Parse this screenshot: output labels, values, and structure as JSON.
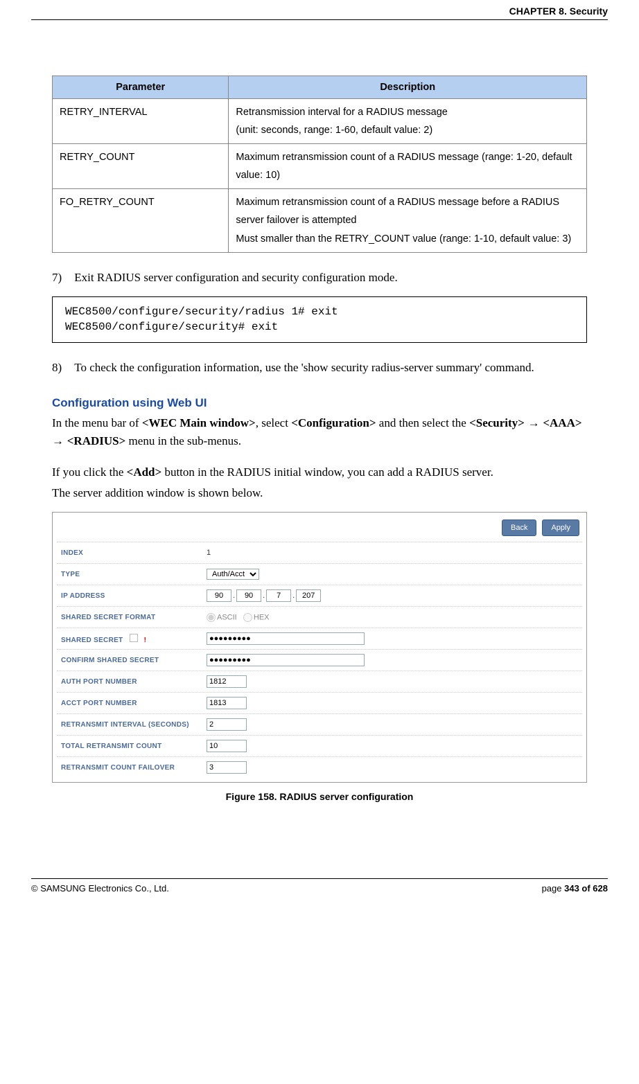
{
  "header": {
    "chapter": "CHAPTER 8. Security"
  },
  "table": {
    "headers": {
      "param": "Parameter",
      "desc": "Description"
    },
    "rows": [
      {
        "param": "RETRY_INTERVAL",
        "desc": "Retransmission interval for a RADIUS message\n(unit: seconds, range: 1-60, default value: 2)"
      },
      {
        "param": "RETRY_COUNT",
        "desc": "Maximum retransmission count of a RADIUS message (range: 1-20, default value: 10)"
      },
      {
        "param": "FO_RETRY_COUNT",
        "desc": "Maximum retransmission count of a RADIUS message before a RADIUS server failover is attempted\nMust smaller than the RETRY_COUNT value (range: 1-10, default value: 3)"
      }
    ]
  },
  "steps": {
    "s7": {
      "num": "7)",
      "text": "Exit RADIUS server configuration and security configuration mode."
    },
    "s8": {
      "num": "8)",
      "text": "To check the configuration information, use the 'show security radius-server summary' command."
    }
  },
  "code": "WEC8500/configure/security/radius 1# exit\nWEC8500/configure/security# exit",
  "section": {
    "title": "Configuration using Web UI",
    "p1a": "In the menu bar of ",
    "p1b": "<WEC Main window>",
    "p1c": ", select ",
    "p1d": "<Configuration>",
    "p1e": " and then select the ",
    "p1f": "<Security>",
    "p1g": "<AAA>",
    "p1h": "<RADIUS>",
    "p1i": " menu in the sub-menus.",
    "p2a": "If you click the ",
    "p2b": "<Add>",
    "p2c": " button in the RADIUS initial window, you can add a RADIUS server.",
    "p3": "The server addition window is shown below."
  },
  "screenshot": {
    "buttons": {
      "back": "Back",
      "apply": "Apply"
    },
    "rows": {
      "index": {
        "label": "INDEX",
        "value": "1"
      },
      "type": {
        "label": "TYPE",
        "value": "Auth/Acct"
      },
      "ip": {
        "label": "IP ADDRESS",
        "o1": "90",
        "o2": "90",
        "o3": "7",
        "o4": "207"
      },
      "ssf": {
        "label": "SHARED SECRET FORMAT",
        "opt1": "ASCII",
        "opt2": "HEX"
      },
      "ss": {
        "label": "SHARED SECRET",
        "value": "●●●●●●●●●"
      },
      "css": {
        "label": "CONFIRM SHARED SECRET",
        "value": "●●●●●●●●●"
      },
      "auth": {
        "label": "AUTH PORT NUMBER",
        "value": "1812"
      },
      "acct": {
        "label": "ACCT PORT NUMBER",
        "value": "1813"
      },
      "retint": {
        "label": "RETRANSMIT INTERVAL (SECONDS)",
        "value": "2"
      },
      "tot": {
        "label": "TOTAL RETRANSMIT COUNT",
        "value": "10"
      },
      "fail": {
        "label": "RETRANSMIT COUNT FAILOVER",
        "value": "3"
      }
    }
  },
  "figure_caption": "Figure 158. RADIUS server configuration",
  "footer": {
    "left": "© SAMSUNG Electronics Co., Ltd.",
    "right_a": "page ",
    "right_b": "343 of 628"
  },
  "arrow": " → "
}
